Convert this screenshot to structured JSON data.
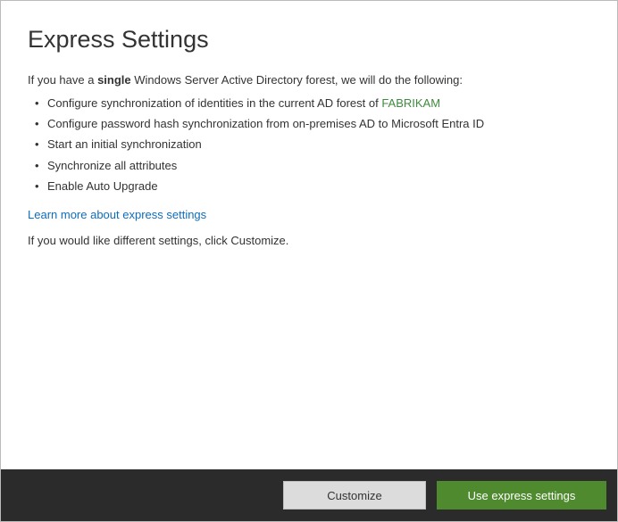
{
  "title": "Express Settings",
  "intro": {
    "prefix": "If you have a ",
    "bold": "single",
    "suffix": " Windows Server Active Directory forest, we will do the following:"
  },
  "bullets": [
    {
      "prefix": "Configure synchronization of identities in the current AD forest of ",
      "forest": "FABRIKAM"
    },
    {
      "text": "Configure password hash synchronization from on-premises AD to Microsoft Entra ID"
    },
    {
      "text": "Start an initial synchronization"
    },
    {
      "text": "Synchronize all attributes"
    },
    {
      "text": "Enable Auto Upgrade"
    }
  ],
  "learn_more": "Learn more about express settings",
  "custom_note": "If you would like different settings, click Customize.",
  "footer": {
    "customize": "Customize",
    "use_express": "Use express settings"
  }
}
